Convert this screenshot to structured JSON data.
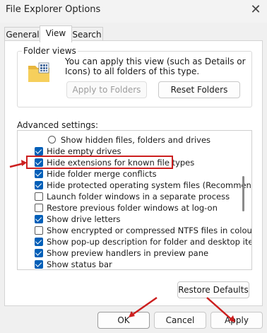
{
  "window": {
    "title": "File Explorer Options",
    "close_glyph": "✕"
  },
  "tabs": [
    {
      "label": "General",
      "active": false
    },
    {
      "label": "View",
      "active": true
    },
    {
      "label": "Search",
      "active": false
    }
  ],
  "folder_views": {
    "label": "Folder views",
    "description": "You can apply this view (such as Details or Icons) to all folders of this type.",
    "apply_button": "Apply to Folders",
    "reset_button": "Reset Folders"
  },
  "advanced": {
    "label": "Advanced settings:",
    "items": [
      {
        "type": "radio",
        "checked": false,
        "label": "Show hidden files, folders and drives"
      },
      {
        "type": "checkbox",
        "checked": true,
        "label": "Hide empty drives"
      },
      {
        "type": "checkbox",
        "checked": true,
        "label": "Hide extensions for known file types"
      },
      {
        "type": "checkbox",
        "checked": true,
        "label": "Hide folder merge conflicts"
      },
      {
        "type": "checkbox",
        "checked": true,
        "label": "Hide protected operating system files (Recommended)"
      },
      {
        "type": "checkbox",
        "checked": false,
        "label": "Launch folder windows in a separate process"
      },
      {
        "type": "checkbox",
        "checked": false,
        "label": "Restore previous folder windows at log-on"
      },
      {
        "type": "checkbox",
        "checked": true,
        "label": "Show drive letters"
      },
      {
        "type": "checkbox",
        "checked": false,
        "label": "Show encrypted or compressed NTFS files in colour"
      },
      {
        "type": "checkbox",
        "checked": true,
        "label": "Show pop-up description for folder and desktop items"
      },
      {
        "type": "checkbox",
        "checked": true,
        "label": "Show preview handlers in preview pane"
      },
      {
        "type": "checkbox",
        "checked": true,
        "label": "Show status bar"
      }
    ],
    "restore_defaults": "Restore Defaults"
  },
  "footer": {
    "ok": "OK",
    "cancel": "Cancel",
    "apply": "Apply"
  },
  "colors": {
    "annotation_red": "#cc1f1f",
    "checkbox_blue": "#005fb8"
  }
}
